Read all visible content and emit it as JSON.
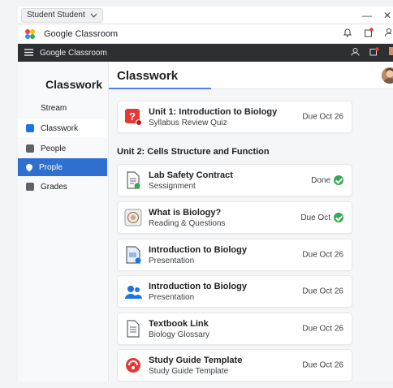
{
  "os": {
    "user_tab": "Student Student",
    "minimize": "—",
    "close": "✕"
  },
  "app": {
    "title": "Google Classroom"
  },
  "class_bar": {
    "title": "Google Classroom"
  },
  "sidebar": {
    "heading": "Classwork",
    "items": [
      {
        "label": "Stream"
      },
      {
        "label": "Classwork"
      },
      {
        "label": "People"
      },
      {
        "label": "Prople"
      },
      {
        "label": "Grades"
      }
    ]
  },
  "main": {
    "title": "Classwork",
    "section_heading": "Unit 2:  Cells Structure and Function",
    "cards": [
      {
        "title": "Unit 1: Introduction to Biology",
        "sub": "Syllabus Review Quiz",
        "due": "Due Oct 26",
        "icon": "quiz-icon"
      },
      {
        "title": "Lab Safety Contract",
        "sub": "Sessignment",
        "due": "Done",
        "icon": "document-icon",
        "done": true
      },
      {
        "title": "What is Biology?",
        "sub": "Reading & Questions",
        "due": "Due Oct",
        "icon": "reading-icon",
        "done": true
      },
      {
        "title": "Introduction to Biology",
        "sub": "Presentation",
        "due": "Due Oct 26",
        "icon": "presentation-icon"
      },
      {
        "title": "Introduction to Biology",
        "sub": "Presentation",
        "due": "Due Oct 26",
        "icon": "people-icon"
      },
      {
        "title": "Textbook Link",
        "sub": "Biology Glossary",
        "due": "Due Oct 26",
        "icon": "link-doc-icon"
      },
      {
        "title": "Study Guide Template",
        "sub": "Study Guide Template",
        "due": "Due Oct 26",
        "icon": "template-icon"
      }
    ]
  },
  "colors": {
    "accent": "#2f6fd0",
    "dark_bar": "#2d2f33",
    "done_green": "#34a853",
    "quiz_red": "#e53935"
  }
}
